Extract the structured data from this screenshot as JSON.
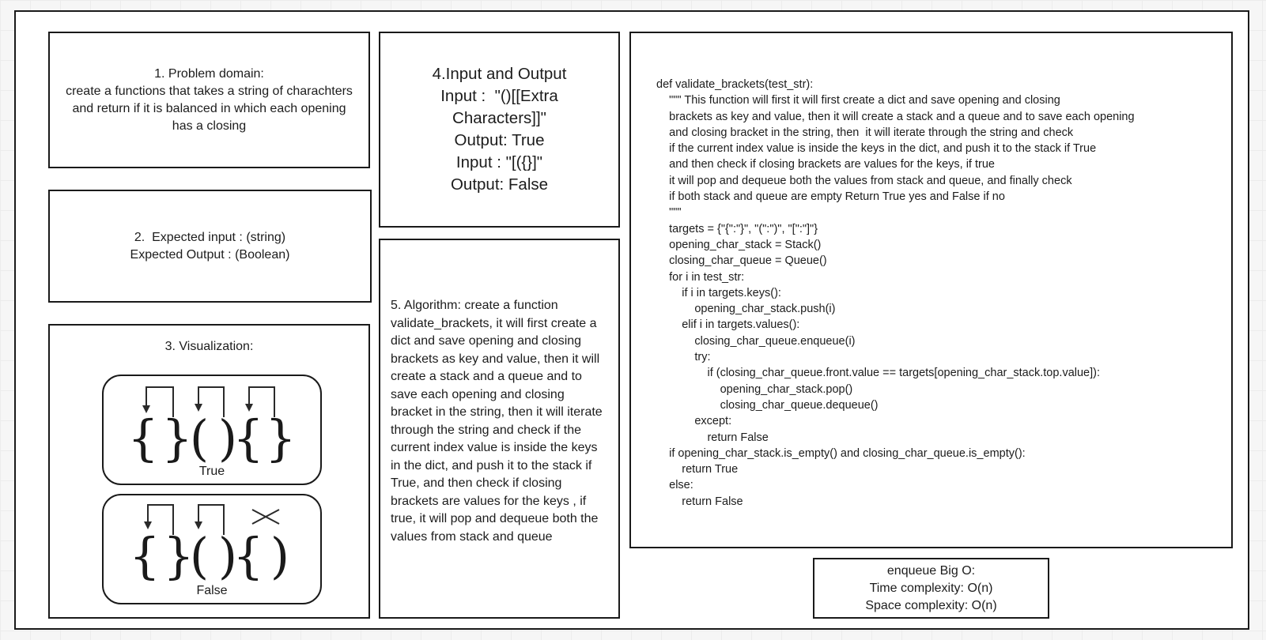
{
  "problem_domain": {
    "lines": [
      "1. Problem domain:",
      "create a functions that takes a string of charachters",
      "and return if it is balanced in which each opening",
      "has a closing"
    ]
  },
  "expected_io": {
    "lines": [
      "2.  Expected input : (string)",
      "Expected Output : (Boolean)"
    ]
  },
  "visualization": {
    "title": "3. Visualization:",
    "example_true": {
      "brackets": [
        "{",
        "}",
        "(",
        ")",
        "{",
        "}"
      ],
      "label": "True"
    },
    "example_false": {
      "brackets": [
        "{",
        "}",
        "(",
        ")",
        "{",
        ")"
      ],
      "label": "False"
    }
  },
  "input_output": {
    "lines": [
      "4.Input and Output",
      "Input :  \"()[[Extra",
      "Characters]]\"",
      "Output: True",
      "Input : \"[({}]\"",
      "Output: False"
    ]
  },
  "algorithm": {
    "text": "5. Algorithm: create a function validate_brackets, it will first create a dict and save opening and closing brackets as key and value, then it will create a stack and a queue and to save each opening and closing bracket in the string, then  it will iterate through the string and check if the current index value is inside the keys in the dict, and push it to the stack if True, and then check if closing brackets are values for the keys , if true, it will pop and dequeue both the values from stack and queue"
  },
  "code": {
    "lines": [
      "def validate_brackets(test_str):",
      "    \"\"\" This function will first it will first create a dict and save opening and closing",
      "    brackets as key and value, then it will create a stack and a queue and to save each opening",
      "    and closing bracket in the string, then  it will iterate through the string and check",
      "    if the current index value is inside the keys in the dict, and push it to the stack if True",
      "    and then check if closing brackets are values for the keys, if true",
      "    it will pop and dequeue both the values from stack and queue, and finally check",
      "    if both stack and queue are empty Return True yes and False if no",
      "    \"\"\"",
      "    targets = {\"{\":\"}\", \"(\":\")\", \"[\":\"]\"}",
      "    opening_char_stack = Stack()",
      "    closing_char_queue = Queue()",
      "    for i in test_str:",
      "        if i in targets.keys():",
      "            opening_char_stack.push(i)",
      "        elif i in targets.values():",
      "            closing_char_queue.enqueue(i)",
      "            try:",
      "                if (closing_char_queue.front.value == targets[opening_char_stack.top.value]):",
      "                    opening_char_stack.pop()",
      "                    closing_char_queue.dequeue()",
      "            except:",
      "                return False",
      "    if opening_char_stack.is_empty() and closing_char_queue.is_empty():",
      "        return True",
      "    else:",
      "        return False"
    ]
  },
  "big_o": {
    "lines": [
      "enqueue Big O:",
      "Time complexity: O(n)",
      "Space complexity: O(n)"
    ]
  }
}
